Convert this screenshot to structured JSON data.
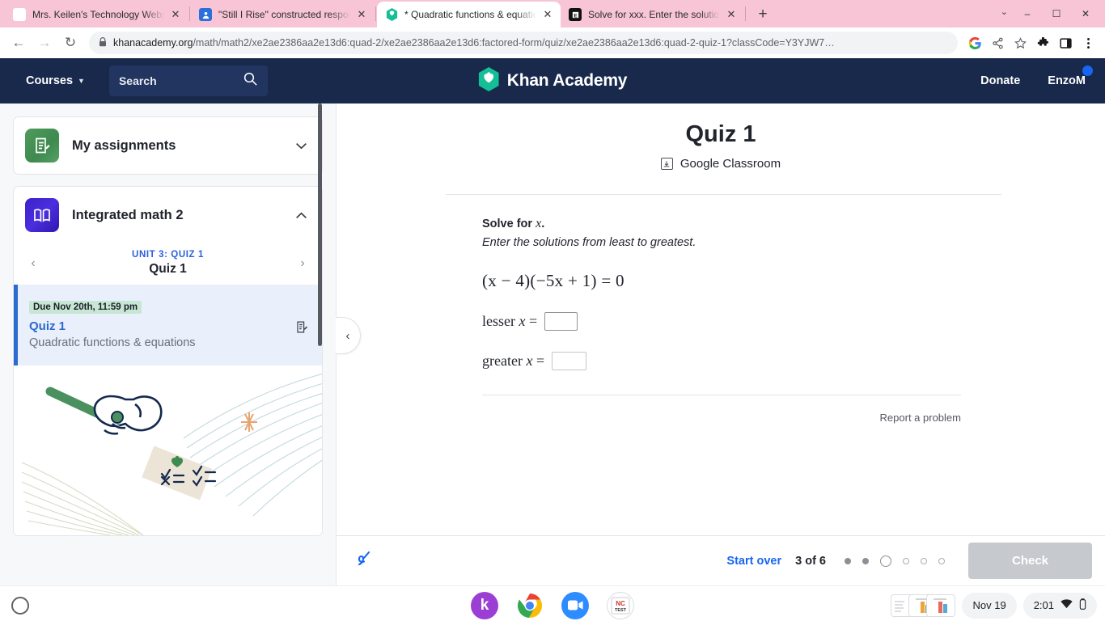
{
  "browser": {
    "tabs": [
      {
        "title": "Mrs. Keilen's Technology Webpage",
        "favicon": "w-icon",
        "active": false
      },
      {
        "title": "\"Still I Rise\" constructed response",
        "favicon": "docs-icon",
        "active": false
      },
      {
        "title": "* Quadratic functions & equations",
        "favicon": "khan-academy-icon",
        "active": true
      },
      {
        "title": "Solve for xxx. Enter the solutions",
        "favicon": "dark-app-icon",
        "active": false
      }
    ],
    "new_tab_label": "+",
    "close_label": "✕",
    "window_controls": {
      "minimize": "–",
      "maximize": "☐",
      "close": "✕",
      "tab_search": "⌄"
    },
    "nav": {
      "back": "←",
      "forward": "→",
      "reload": "↻"
    },
    "url": {
      "lock_icon": "lock-icon",
      "domain": "khanacademy.org",
      "path": "/math/math2/xe2ae2386aa2e13d6:quad-2/xe2ae2386aa2e13d6:factored-form/quiz/xe2ae2386aa2e13d6:quad-2-quiz-1?classCode=Y3YJW7…"
    },
    "omni_icons": [
      "google-icon",
      "share-icon",
      "bookmark-star-icon",
      "extensions-puzzle-icon",
      "side-panel-icon",
      "chrome-menu-icon"
    ]
  },
  "ka_header": {
    "courses_label": "Courses",
    "search_placeholder": "Search",
    "search_icon": "search-icon",
    "logo_text": "Khan Academy",
    "donate_label": "Donate",
    "user_label": "EnzoM"
  },
  "sidebar": {
    "my_assignments": {
      "label": "My assignments",
      "icon": "assignment-clipboard-icon",
      "chevron": "⌄",
      "expanded": false
    },
    "course": {
      "label": "Integrated math 2",
      "icon": "open-book-icon",
      "chevron": "⌃",
      "expanded": true
    },
    "unit_nav": {
      "prev": "‹",
      "next": "›",
      "unit_label": "UNIT 3: QUIZ 1",
      "unit_name": "Quiz 1"
    },
    "assignment": {
      "due_badge": "Due Nov 20th, 11:59 pm",
      "title": "Quiz 1",
      "subtitle": "Quadratic functions & equations",
      "edit_icon": "edit-assignment-icon"
    }
  },
  "main": {
    "collapse_icon": "‹",
    "title": "Quiz 1",
    "google_classroom": {
      "label": "Google Classroom",
      "icon": "google-classroom-share-icon"
    },
    "question": {
      "prompt_prefix": "Solve for ",
      "prompt_var": "x",
      "prompt_suffix": ".",
      "instruction": "Enter the solutions from least to greatest.",
      "equation": "(x − 4)(−5x + 1) = 0",
      "answers": [
        {
          "label_prefix": "lesser ",
          "label_var": "x",
          "label_eq": " =",
          "value": "",
          "focused": true
        },
        {
          "label_prefix": "greater ",
          "label_var": "x",
          "label_eq": " =",
          "value": "",
          "focused": false
        }
      ]
    },
    "report_problem": "Report a problem"
  },
  "bottom_bar": {
    "pen_icon": "scratchpad-pen-icon",
    "start_over": "Start over",
    "progress_text": "3 of 6",
    "dots": [
      "filled",
      "filled",
      "current",
      "empty",
      "empty",
      "empty"
    ],
    "check_label": "Check"
  },
  "shelf": {
    "launcher_icon": "launcher-circle-icon",
    "apps": [
      {
        "name": "kami-app-icon",
        "glyph": "k"
      },
      {
        "name": "chrome-app-icon",
        "glyph": "",
        "running": true
      },
      {
        "name": "zoom-app-icon",
        "glyph": ""
      },
      {
        "name": "nc-test-app-icon",
        "glyph": "NC TEST"
      }
    ],
    "date": "Nov 19",
    "time": "2:01",
    "wifi_icon": "wifi-icon",
    "battery_icon": "battery-icon"
  },
  "colors": {
    "ka_navy": "#18294c",
    "ka_blue": "#1865f2",
    "tabstrip_pink": "#f7c5d6",
    "due_green": "#c8e6d4",
    "check_disabled": "#c6c9cd"
  }
}
